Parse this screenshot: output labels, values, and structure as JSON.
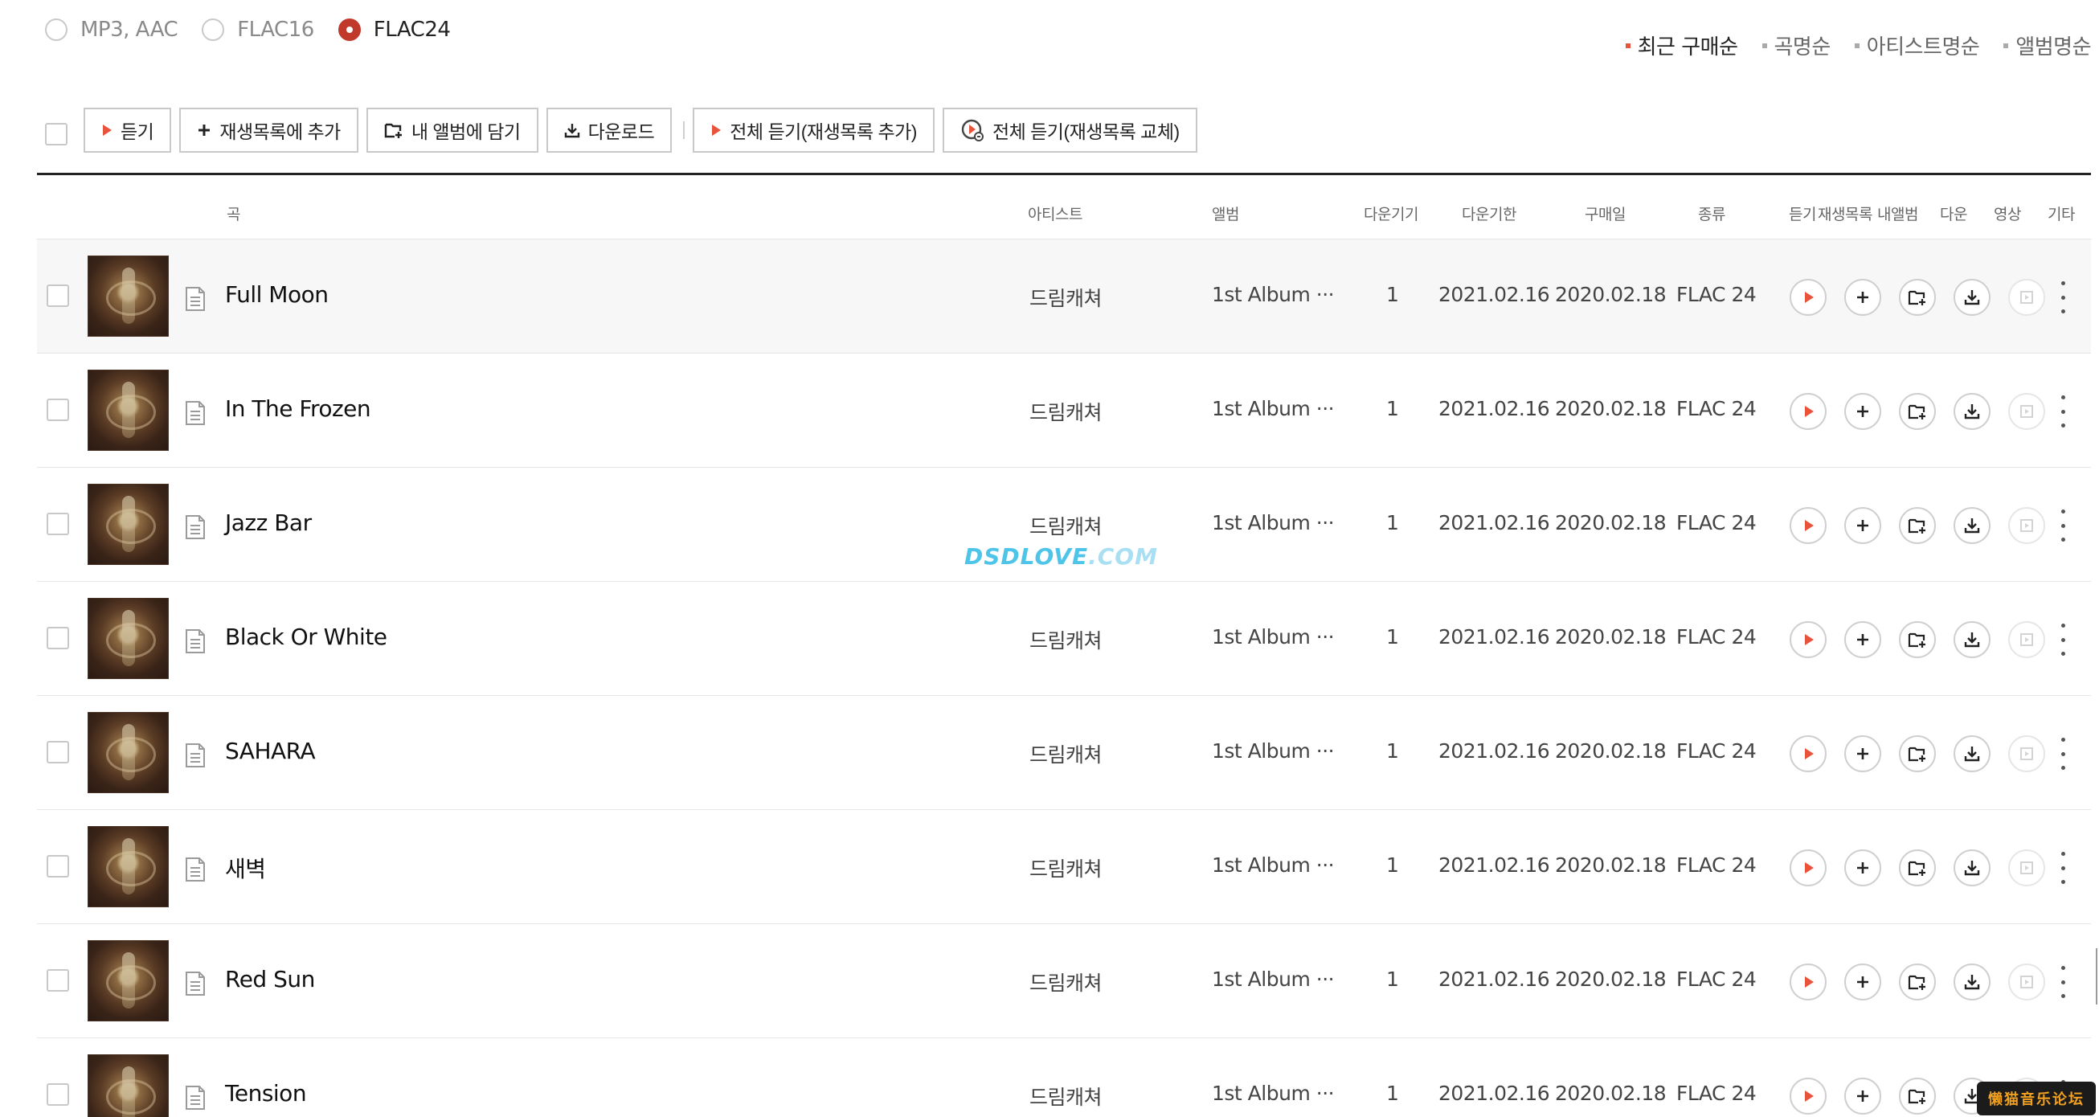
{
  "quality_options": [
    {
      "label": "MP3, AAC",
      "selected": false
    },
    {
      "label": "FLAC16",
      "selected": false
    },
    {
      "label": "FLAC24",
      "selected": true
    }
  ],
  "sort_options": [
    {
      "label": "최근 구매순",
      "active": true
    },
    {
      "label": "곡명순",
      "active": false
    },
    {
      "label": "아티스트명순",
      "active": false
    },
    {
      "label": "앨범명순",
      "active": false
    }
  ],
  "toolbar": {
    "listen": "듣기",
    "add_playlist": "재생목록에 추가",
    "add_my_album": "내 앨범에 담기",
    "download": "다운로드",
    "play_all_add": "전체 듣기(재생목록 추가)",
    "play_all_replace": "전체 듣기(재생목록 교체)"
  },
  "columns": {
    "song": "곡",
    "artist": "아티스트",
    "album": "앨범",
    "download_devices": "다운기기",
    "download_deadline": "다운기한",
    "purchase_date": "구매일",
    "type": "종류",
    "listen": "듣기",
    "playlist": "재생목록",
    "my_album": "내앨범",
    "download": "다운",
    "video": "영상",
    "etc": "기타"
  },
  "rows": [
    {
      "title": "Full Moon",
      "artist": "드림캐쳐",
      "album": "1st Album ···",
      "devices": "1",
      "deadline": "2021.02.16",
      "purchased": "2020.02.18",
      "type": "FLAC 24"
    },
    {
      "title": "In The Frozen",
      "artist": "드림캐쳐",
      "album": "1st Album ···",
      "devices": "1",
      "deadline": "2021.02.16",
      "purchased": "2020.02.18",
      "type": "FLAC 24"
    },
    {
      "title": "Jazz Bar",
      "artist": "드림캐쳐",
      "album": "1st Album ···",
      "devices": "1",
      "deadline": "2021.02.16",
      "purchased": "2020.02.18",
      "type": "FLAC 24"
    },
    {
      "title": "Black Or White",
      "artist": "드림캐쳐",
      "album": "1st Album ···",
      "devices": "1",
      "deadline": "2021.02.16",
      "purchased": "2020.02.18",
      "type": "FLAC 24"
    },
    {
      "title": "SAHARA",
      "artist": "드림캐쳐",
      "album": "1st Album ···",
      "devices": "1",
      "deadline": "2021.02.16",
      "purchased": "2020.02.18",
      "type": "FLAC 24"
    },
    {
      "title": "새벽",
      "artist": "드림캐쳐",
      "album": "1st Album ···",
      "devices": "1",
      "deadline": "2021.02.16",
      "purchased": "2020.02.18",
      "type": "FLAC 24"
    },
    {
      "title": "Red Sun",
      "artist": "드림캐쳐",
      "album": "1st Album ···",
      "devices": "1",
      "deadline": "2021.02.16",
      "purchased": "2020.02.18",
      "type": "FLAC 24"
    },
    {
      "title": "Tension",
      "artist": "드림캐쳐",
      "album": "1st Album ···",
      "devices": "1",
      "deadline": "2021.02.16",
      "purchased": "2020.02.18",
      "type": "FLAC 24"
    }
  ],
  "watermark": {
    "brand": "DSDLOVE",
    "domain": ".COM"
  },
  "badge": "懒猫音乐论坛",
  "colors": {
    "accent": "#e8533c",
    "radio_selected": "#c0392b",
    "watermark": "#4ec5e8"
  }
}
